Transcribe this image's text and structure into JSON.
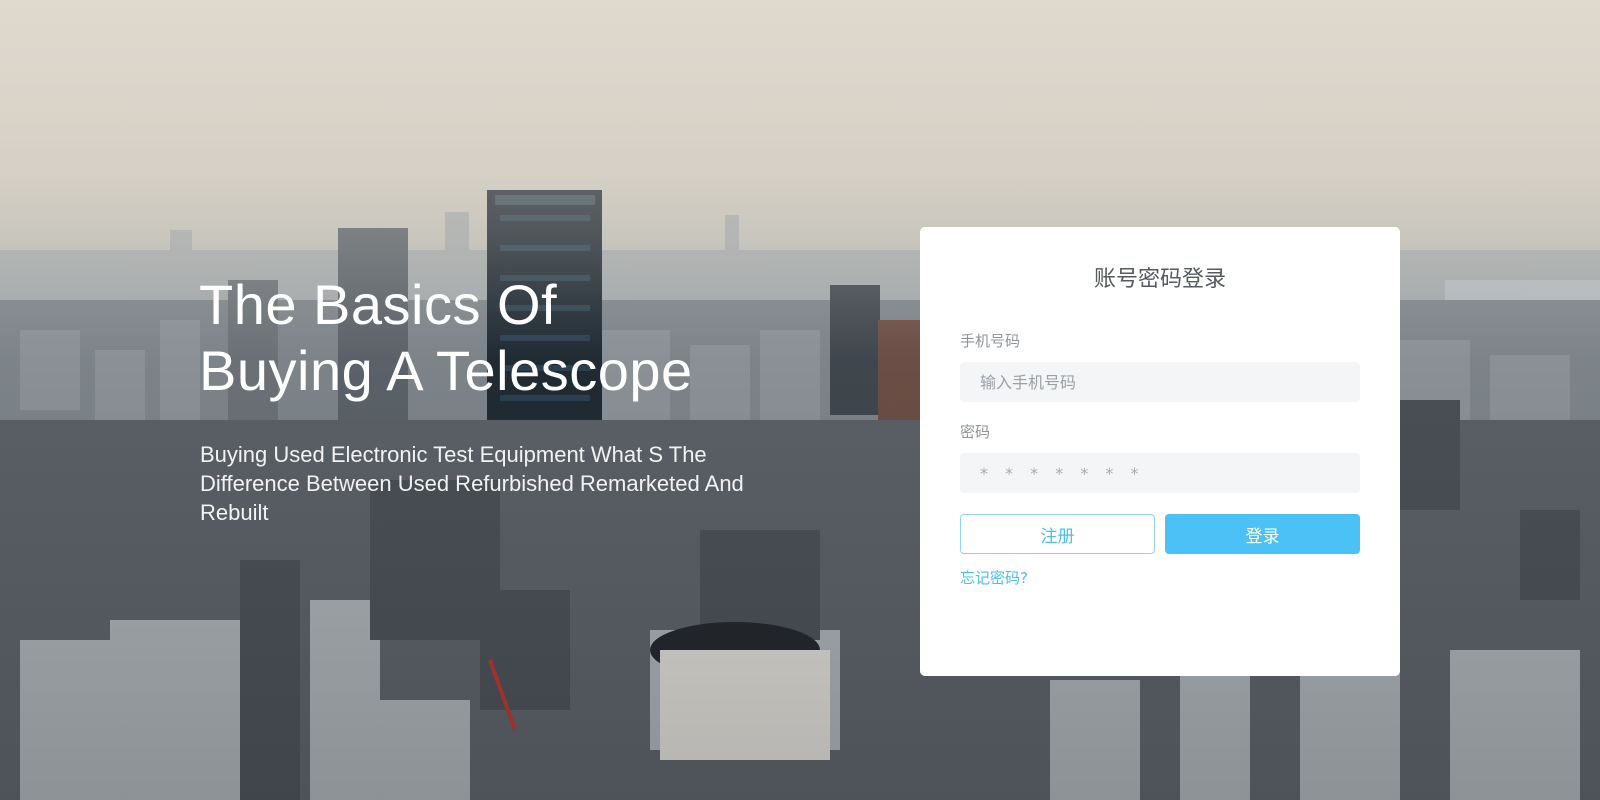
{
  "hero": {
    "title_line1": "The Basics Of",
    "title_line2": "Buying A Telescope",
    "subtitle": "Buying Used Electronic Test Equipment What S The Difference Between Used Refurbished Remarketed And Rebuilt"
  },
  "login": {
    "title": "账号密码登录",
    "phone_label": "手机号码",
    "phone_placeholder": "输入手机号码",
    "phone_value": "",
    "password_label": "密码",
    "password_placeholder": "* * * * * * *",
    "password_value": "",
    "register_label": "注册",
    "login_label": "登录",
    "forgot_label": "忘记密码?"
  },
  "colors": {
    "accent": "#4cc1f6",
    "accent_text": "#4bbfef",
    "card_bg": "#ffffff",
    "input_bg": "#f4f5f7"
  }
}
